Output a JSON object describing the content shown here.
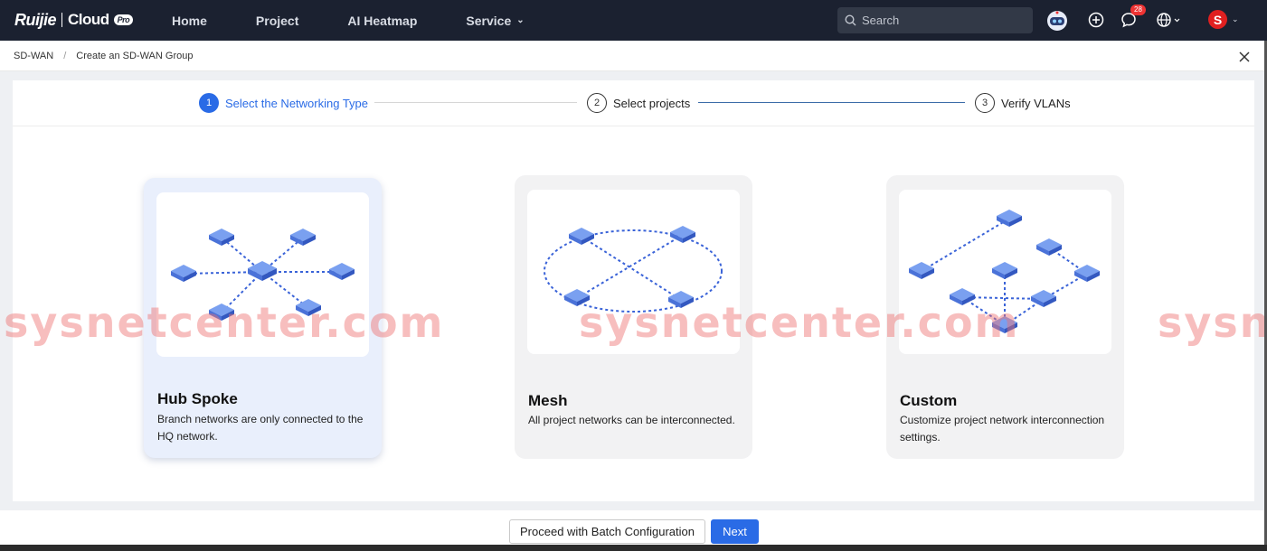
{
  "header": {
    "brand": "Ruijie",
    "product": "Cloud",
    "edition": "Pro",
    "nav": [
      {
        "label": "Home"
      },
      {
        "label": "Project"
      },
      {
        "label": "AI Heatmap"
      },
      {
        "label": "Service"
      }
    ],
    "search_placeholder": "Search",
    "notification_count": "28",
    "user_initial": "S"
  },
  "breadcrumb": [
    "SD-WAN",
    "Create an SD-WAN Group"
  ],
  "steps": [
    {
      "num": "1",
      "label": "Select the Networking Type"
    },
    {
      "num": "2",
      "label": "Select projects"
    },
    {
      "num": "3",
      "label": "Verify VLANs"
    }
  ],
  "cards": [
    {
      "title": "Hub Spoke",
      "desc": "Branch networks are only connected to the HQ network."
    },
    {
      "title": "Mesh",
      "desc": "All project networks can be interconnected."
    },
    {
      "title": "Custom",
      "desc": "Customize project network interconnection settings."
    }
  ],
  "watermark": "sysnetcenter.com",
  "footer": {
    "batch_label": "Proceed with Batch Configuration",
    "next_label": "Next"
  },
  "colors": {
    "accent": "#2a6be6",
    "topbar": "#1b2130"
  }
}
